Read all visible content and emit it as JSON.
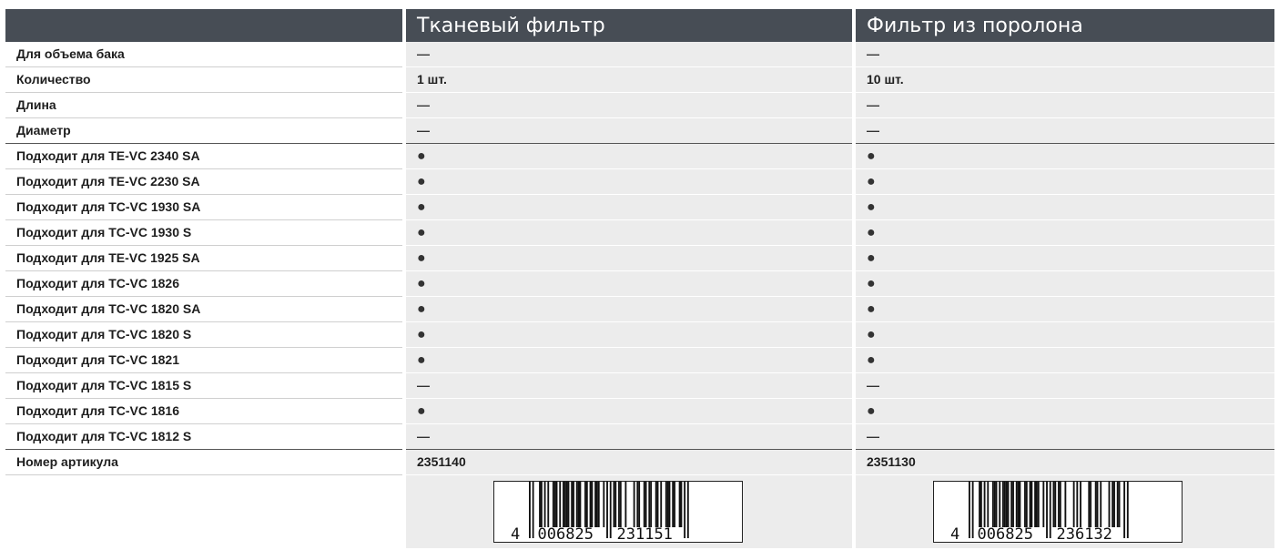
{
  "header": {
    "label_col": "",
    "col1": "Тканевый фильтр",
    "col2": "Фильтр из поролона"
  },
  "rows": [
    {
      "label": "Для объема бака",
      "v1": "—",
      "v2": "—"
    },
    {
      "label": "Количество",
      "v1": "1 шт.",
      "v2": "10 шт."
    },
    {
      "label": "Длина",
      "v1": "—",
      "v2": "—"
    },
    {
      "label": "Диаметр",
      "v1": "—",
      "v2": "—"
    },
    {
      "label": "Подходит для TE-VC 2340 SA",
      "v1": "●",
      "v2": "●"
    },
    {
      "label": "Подходит для TE-VC 2230 SA",
      "v1": "●",
      "v2": "●"
    },
    {
      "label": "Подходит для TC-VC 1930 SA",
      "v1": "●",
      "v2": "●"
    },
    {
      "label": "Подходит для TC-VC 1930 S",
      "v1": "●",
      "v2": "●"
    },
    {
      "label": "Подходит для TE-VC 1925 SA",
      "v1": "●",
      "v2": "●"
    },
    {
      "label": "Подходит для TC-VC 1826",
      "v1": "●",
      "v2": "●"
    },
    {
      "label": "Подходит для TC-VC 1820 SA",
      "v1": "●",
      "v2": "●"
    },
    {
      "label": "Подходит для TC-VC 1820 S",
      "v1": "●",
      "v2": "●"
    },
    {
      "label": "Подходит для TC-VC 1821",
      "v1": "●",
      "v2": "●"
    },
    {
      "label": "Подходит для TC-VC 1815 S",
      "v1": "—",
      "v2": "—"
    },
    {
      "label": "Подходит для TC-VC 1816",
      "v1": "●",
      "v2": "●"
    },
    {
      "label": "Подходит для TC-VC 1812 S",
      "v1": "—",
      "v2": "—"
    },
    {
      "label": "Номер артикула",
      "v1": "2351140",
      "v2": "2351130"
    }
  ],
  "barcodes": [
    {
      "lead": "4",
      "left": "006825",
      "right": "231151"
    },
    {
      "lead": "4",
      "left": "006825",
      "right": "236132"
    }
  ],
  "colors": {
    "header_bg": "#474d55",
    "header_text": "#ffffff",
    "value_bg": "#ececec",
    "text": "#1e1e1e"
  }
}
